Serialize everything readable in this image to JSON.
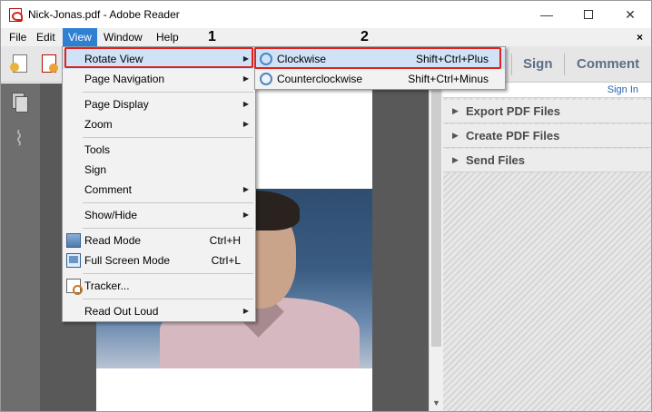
{
  "window": {
    "title": "Nick-Jonas.pdf - Adobe Reader",
    "controls": {
      "minimize": "—",
      "maximize": "",
      "close": "✕"
    }
  },
  "menubar": {
    "items": [
      "File",
      "Edit",
      "View",
      "Window",
      "Help"
    ],
    "active": "View",
    "doc_close": "×"
  },
  "toolbar": {
    "sign_label": "Sign",
    "comment_label": "Comment"
  },
  "right_pane": {
    "sign_in": "Sign In",
    "sections": [
      "Export PDF Files",
      "Create PDF Files",
      "Send Files"
    ]
  },
  "view_menu": {
    "items": [
      {
        "label": "Rotate View",
        "shortcut": "",
        "submenu": true,
        "highlighted": true
      },
      {
        "label": "Page Navigation",
        "shortcut": "",
        "submenu": true
      },
      {
        "label": "Page Display",
        "shortcut": "",
        "submenu": true
      },
      {
        "label": "Zoom",
        "shortcut": "",
        "submenu": true
      },
      {
        "label": "Tools",
        "shortcut": "",
        "submenu": false
      },
      {
        "label": "Sign",
        "shortcut": "",
        "submenu": false
      },
      {
        "label": "Comment",
        "shortcut": "",
        "submenu": true
      },
      {
        "label": "Show/Hide",
        "shortcut": "",
        "submenu": true
      },
      {
        "label": "Read Mode",
        "shortcut": "Ctrl+H",
        "submenu": false,
        "icon": "read-mode-icon"
      },
      {
        "label": "Full Screen Mode",
        "shortcut": "Ctrl+L",
        "submenu": false,
        "icon": "full-screen-icon"
      },
      {
        "label": "Tracker...",
        "shortcut": "",
        "submenu": false,
        "icon": "tracker-icon"
      },
      {
        "label": "Read Out Loud",
        "shortcut": "",
        "submenu": true
      }
    ]
  },
  "rotate_submenu": {
    "items": [
      {
        "label": "Clockwise",
        "shortcut": "Shift+Ctrl+Plus",
        "highlighted": true,
        "icon": "rotate-clockwise-icon"
      },
      {
        "label": "Counterclockwise",
        "shortcut": "Shift+Ctrl+Minus",
        "icon": "rotate-counterclockwise-icon"
      }
    ]
  },
  "annotations": {
    "step1": "1",
    "step2": "2",
    "highlight_color": "#e0211c"
  },
  "colors": {
    "menu_active": "#2f7fd2",
    "menu_highlight": "#cfe2f6",
    "toolbar_text": "#5a6f87",
    "link": "#2a66b0"
  }
}
